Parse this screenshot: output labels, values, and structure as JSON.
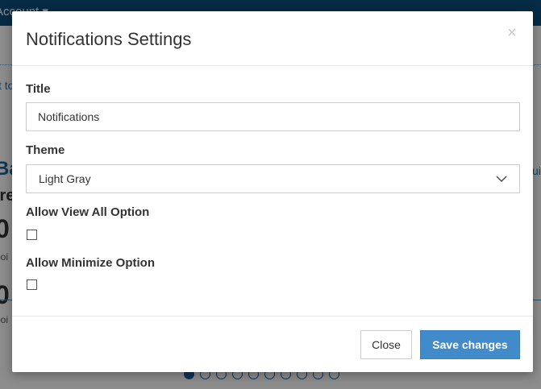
{
  "background": {
    "nav_account": "Account ▾",
    "frag_link1": "t to",
    "frag_heading": "Ba",
    "frag_sub": "ire",
    "frag_big1": "0",
    "frag_small1": "poi",
    "frag_big2": "0",
    "frag_small2": "poi",
    "frag_right": "ui",
    "carousel_total": 10,
    "carousel_active_index": 0
  },
  "modal": {
    "title": "Notifications Settings",
    "close_symbol": "×",
    "fields": {
      "title_label": "Title",
      "title_value": "Notifications",
      "theme_label": "Theme",
      "theme_selected": "Light Gray",
      "view_all_label": "Allow View All Option",
      "view_all_checked": false,
      "minimize_label": "Allow Minimize Option",
      "minimize_checked": false
    },
    "footer": {
      "close_label": "Close",
      "save_label": "Save changes"
    }
  },
  "colors": {
    "nav": "#0b4f7c",
    "primary_button": "#428bca",
    "link": "#2d73b5"
  }
}
